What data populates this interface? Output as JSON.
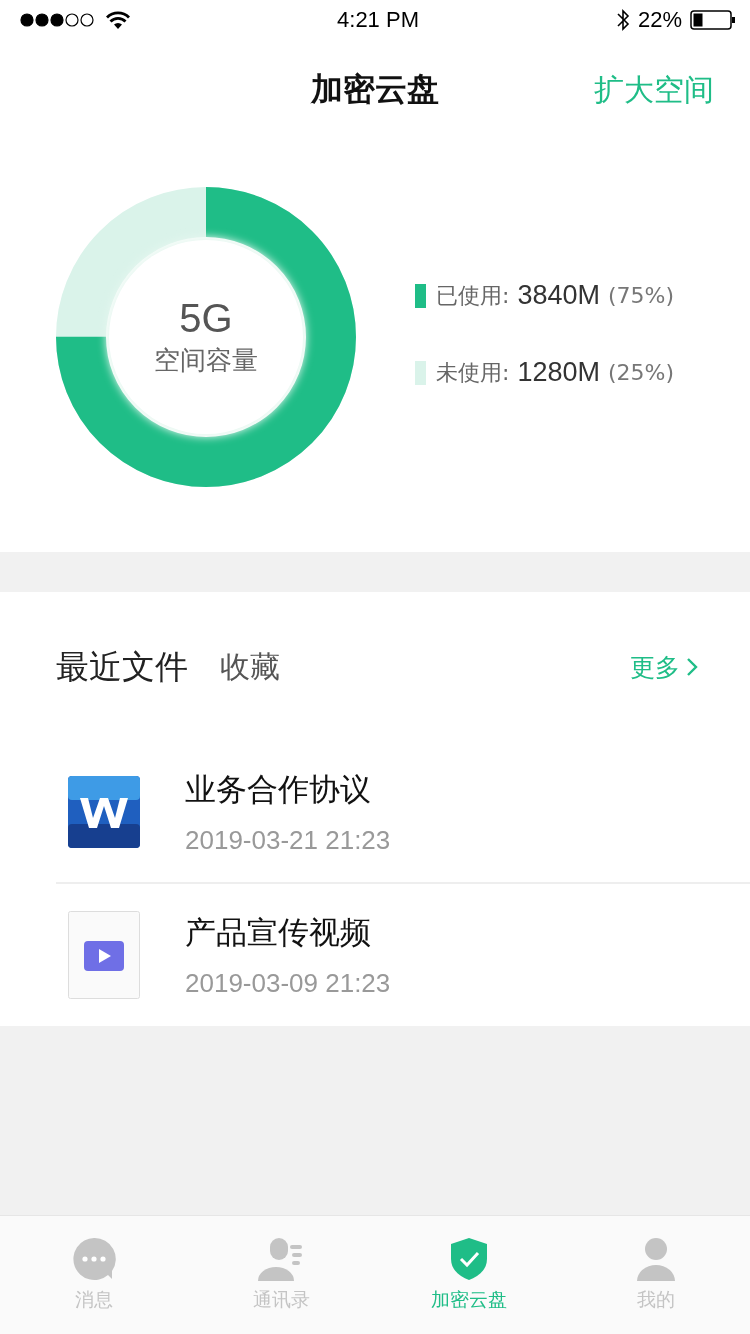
{
  "status_bar": {
    "time": "4:21 PM",
    "battery": "22%"
  },
  "nav": {
    "title": "加密云盘",
    "action": "扩大空间"
  },
  "storage": {
    "total": "5G",
    "caption": "空间容量",
    "level": 0.75,
    "legend": [
      {
        "label": "已使用:",
        "value": "3840M",
        "percent": "(75%)",
        "color": "#1fbd87"
      },
      {
        "label": "未使用:",
        "value": "1280M",
        "percent": "(25%)",
        "color": "#daf3ea"
      }
    ]
  },
  "files": {
    "tabs": [
      {
        "label": "最近文件",
        "selected": true
      },
      {
        "label": "收藏",
        "selected": false
      }
    ],
    "more": "更多",
    "items": [
      {
        "kind": "word",
        "name": "业务合作协议",
        "date": "2019-03-21 21:23"
      },
      {
        "kind": "video",
        "name": "产品宣传视频",
        "date": "2019-03-09 21:23"
      }
    ]
  },
  "tab_bar": [
    {
      "label": "消息",
      "kind": "chat",
      "selected": false
    },
    {
      "label": "通讯录",
      "kind": "contacts",
      "selected": false
    },
    {
      "label": "加密云盘",
      "kind": "shield",
      "selected": true
    },
    {
      "label": "我的",
      "kind": "person",
      "selected": false
    }
  ]
}
